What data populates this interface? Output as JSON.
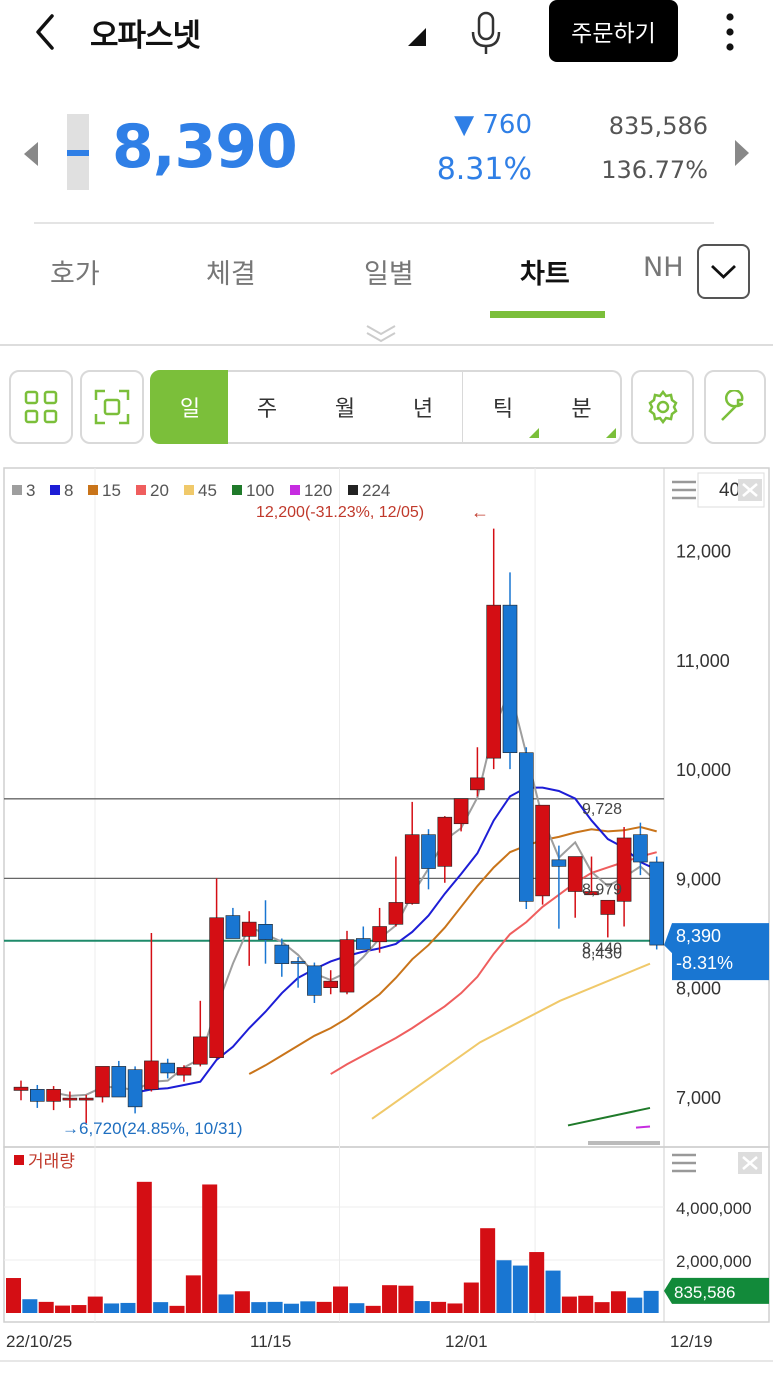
{
  "header": {
    "title": "오파스넷",
    "order_button": "주문하기"
  },
  "quote": {
    "price": "8,390",
    "change": "▼ 760",
    "change_pct": "8.31%",
    "volume": "835,586",
    "volume_ratio": "136.77%"
  },
  "tabs": [
    {
      "label": "호가"
    },
    {
      "label": "체결"
    },
    {
      "label": "일별"
    },
    {
      "label": "차트"
    },
    {
      "label": "NH"
    }
  ],
  "toolbar": {
    "periods": [
      "일",
      "주",
      "월",
      "년",
      "틱",
      "분"
    ],
    "active": "일"
  },
  "colors": {
    "up": "#d40e14",
    "down": "#1976d2",
    "accent": "#7bbf3a",
    "price_tag": "#1976d2",
    "volume_tag": "#128a3a"
  },
  "chart_data": {
    "type": "candlestick",
    "legend": [
      {
        "name": "3",
        "color": "#9e9e9e"
      },
      {
        "name": "8",
        "color": "#1d1dd6"
      },
      {
        "name": "15",
        "color": "#c9741a"
      },
      {
        "name": "20",
        "color": "#ef5e5e"
      },
      {
        "name": "45",
        "color": "#f0c96a"
      },
      {
        "name": "100",
        "color": "#1f7a2a"
      },
      {
        "name": "120",
        "color": "#c62ce0"
      },
      {
        "name": "224",
        "color": "#222222"
      }
    ],
    "max_label": "12,200(-31.23%, 12/05)",
    "min_label": "6,720(24.85%, 10/31)",
    "candles_count_label": "40",
    "y_ticks": [
      "12,000",
      "11,000",
      "10,000",
      "9,000",
      "8,000",
      "7,000"
    ],
    "hlines": [
      9728,
      9000,
      8430
    ],
    "hline_labels": [
      "9,728",
      "8,979",
      "8,440",
      "8,430"
    ],
    "price_tag": "8,390",
    "price_tag_pct": "-8.31%",
    "ohlc": [
      [
        7060,
        7150,
        6970,
        7090
      ],
      [
        7070,
        7110,
        6900,
        6960
      ],
      [
        6960,
        7100,
        6880,
        7070
      ],
      [
        6980,
        7050,
        6900,
        6990
      ],
      [
        6980,
        7020,
        6760,
        6990
      ],
      [
        7000,
        7270,
        6950,
        7280
      ],
      [
        7280,
        7330,
        7010,
        7000
      ],
      [
        7250,
        7280,
        6850,
        6910
      ],
      [
        7070,
        8500,
        7050,
        7330
      ],
      [
        7310,
        7350,
        7170,
        7220
      ],
      [
        7200,
        7290,
        7140,
        7270
      ],
      [
        7300,
        7880,
        7280,
        7550
      ],
      [
        7360,
        9000,
        7350,
        8640
      ],
      [
        8660,
        8730,
        8450,
        8450
      ],
      [
        8470,
        8700,
        8200,
        8600
      ],
      [
        8580,
        8800,
        8220,
        8440
      ],
      [
        8390,
        8450,
        8100,
        8220
      ],
      [
        8240,
        8280,
        8000,
        8230
      ],
      [
        8200,
        8230,
        7860,
        7930
      ],
      [
        8000,
        8160,
        7940,
        8060
      ],
      [
        7960,
        8520,
        7940,
        8440
      ],
      [
        8450,
        8560,
        8360,
        8350
      ],
      [
        8420,
        8730,
        8320,
        8560
      ],
      [
        8580,
        9200,
        8560,
        8780
      ],
      [
        8770,
        9700,
        8760,
        9400
      ],
      [
        9400,
        9450,
        8900,
        9090
      ],
      [
        9110,
        9570,
        8960,
        9560
      ],
      [
        9500,
        9680,
        9430,
        9730
      ],
      [
        9810,
        10200,
        9750,
        9920
      ],
      [
        10100,
        12200,
        10000,
        11500
      ],
      [
        11500,
        11800,
        10000,
        10150
      ],
      [
        10150,
        10200,
        8720,
        8790
      ],
      [
        8840,
        9500,
        8760,
        9670
      ],
      [
        9170,
        9300,
        8540,
        9110
      ],
      [
        8880,
        9200,
        8640,
        9200
      ],
      [
        8850,
        9200,
        8860,
        8880
      ],
      [
        8670,
        8710,
        8460,
        8800
      ],
      [
        8790,
        9470,
        8560,
        9370
      ],
      [
        9400,
        9510,
        9030,
        9150
      ],
      [
        9150,
        9200,
        8350,
        8390
      ]
    ],
    "ma3": [
      null,
      null,
      7040,
      7010,
      7020,
      7090,
      7090,
      7060,
      7140,
      7150,
      7270,
      7350,
      7820,
      8220,
      8560,
      8490,
      8420,
      8300,
      8130,
      8070,
      8140,
      8280,
      8450,
      8570,
      8850,
      9090,
      9350,
      9460,
      9740,
      10360,
      10730,
      10140,
      9550,
      9190,
      9330,
      9060,
      8930,
      9010,
      9110,
      8970
    ],
    "ma8": [
      null,
      null,
      null,
      null,
      null,
      null,
      null,
      7040,
      7070,
      7080,
      7110,
      7140,
      7340,
      7460,
      7630,
      7780,
      7950,
      8090,
      8170,
      8240,
      8290,
      8330,
      8360,
      8400,
      8510,
      8660,
      8860,
      9040,
      9230,
      9530,
      9750,
      9830,
      9830,
      9800,
      9730,
      9530,
      9360,
      9280,
      9150,
      9080
    ],
    "ma15": [
      null,
      null,
      null,
      null,
      null,
      null,
      null,
      null,
      null,
      null,
      null,
      null,
      null,
      null,
      7210,
      7290,
      7380,
      7470,
      7560,
      7630,
      7720,
      7830,
      7940,
      8090,
      8260,
      8390,
      8550,
      8740,
      8930,
      9100,
      9240,
      9300,
      9350,
      9380,
      9420,
      9450,
      9430,
      9440,
      9470,
      9430
    ],
    "ma20": [
      null,
      null,
      null,
      null,
      null,
      null,
      null,
      null,
      null,
      null,
      null,
      null,
      null,
      null,
      null,
      null,
      null,
      null,
      null,
      7210,
      7300,
      7380,
      7460,
      7540,
      7630,
      7730,
      7830,
      7950,
      8100,
      8310,
      8490,
      8600,
      8740,
      8850,
      8960,
      9050,
      9100,
      9150,
      9200,
      9240
    ],
    "ma45": [
      null,
      null,
      null,
      null,
      null,
      null,
      null,
      null,
      null,
      null,
      null,
      null,
      null,
      null,
      null,
      null,
      null,
      null,
      null,
      null,
      null,
      null,
      null,
      null,
      null,
      null,
      null,
      null,
      null,
      null,
      null,
      null,
      null,
      null,
      null,
      null,
      null,
      null,
      null,
      8200
    ],
    "volume_title": "거래량",
    "volume_ticks": [
      "4,000,000",
      "2,000,000"
    ],
    "volume_tag": "835,586",
    "volume": [
      1320000,
      520000,
      420000,
      280000,
      300000,
      620000,
      360000,
      380000,
      4950000,
      410000,
      270000,
      1420000,
      4850000,
      700000,
      820000,
      410000,
      420000,
      350000,
      440000,
      420000,
      1000000,
      370000,
      270000,
      1050000,
      1030000,
      450000,
      420000,
      360000,
      1150000,
      3200000,
      1990000,
      1790000,
      2300000,
      1600000,
      620000,
      650000,
      410000,
      820000,
      580000,
      835586
    ],
    "x_ticks": [
      "22/10/25",
      "11/15",
      "12/01",
      "12/19"
    ]
  }
}
